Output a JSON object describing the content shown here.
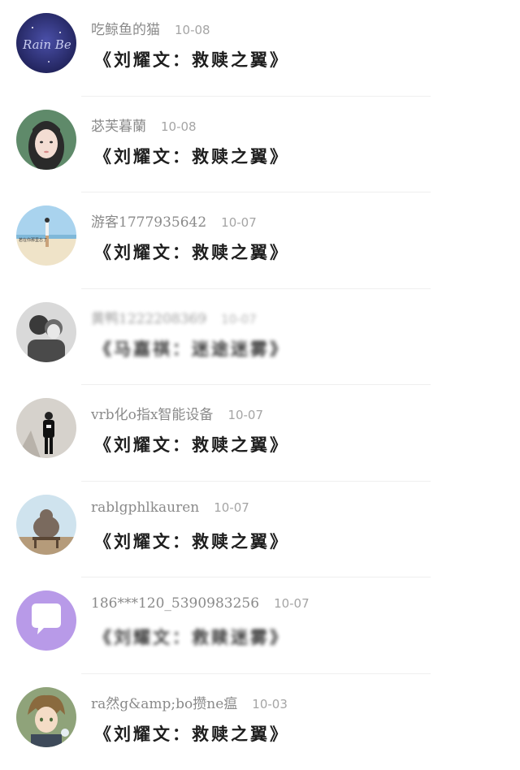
{
  "comments": [
    {
      "name": "吃鲸鱼的猫",
      "date": "10-08",
      "message": "《刘耀文：救赎之翼》",
      "avatar_icon": "night-sky-text-avatar-icon"
    },
    {
      "name": "苾芙暮蘭",
      "date": "10-08",
      "message": "《刘耀文：救赎之翼》",
      "avatar_icon": "girl-portrait-avatar-icon"
    },
    {
      "name": "游客1777935642",
      "date": "10-07",
      "message": "《刘耀文：救赎之翼》",
      "avatar_icon": "beach-figure-avatar-icon"
    },
    {
      "name": "黄鸭1222208369",
      "date": "10-07",
      "message": "《马嘉祺：迷途迷雾》",
      "avatar_icon": "couple-bw-avatar-icon",
      "blurred": true
    },
    {
      "name": "vrb化o指x智能设备",
      "date": "10-07",
      "message": "《刘耀文：救赎之翼》",
      "avatar_icon": "man-standing-avatar-icon"
    },
    {
      "name": "rablgphlkauren",
      "date": "10-07",
      "message": "《刘耀文：救赎之翼》",
      "avatar_icon": "elephant-bench-avatar-icon"
    },
    {
      "name": "186***120_5390983256",
      "date": "10-07",
      "message": "《刘耀文：救赎迷雾》",
      "avatar_icon": "chat-bubble-avatar-icon",
      "blurred": true
    },
    {
      "name": "ra然g&amp;bo攒ne瘟",
      "date": "10-03",
      "message": "《刘耀文：救赎之翼》",
      "avatar_icon": "anime-boy-avatar-icon"
    }
  ]
}
